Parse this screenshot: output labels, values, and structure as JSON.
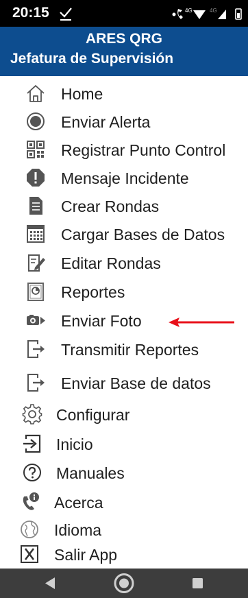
{
  "status": {
    "time": "20:15",
    "net_label": "4G"
  },
  "header": {
    "title": "ARES QRG",
    "subtitle": "Jefatura de Supervisión"
  },
  "menu": [
    {
      "label": "Home",
      "icon": "home-icon"
    },
    {
      "label": "Enviar Alerta",
      "icon": "alert-radio-icon"
    },
    {
      "label": "Registrar Punto Control",
      "icon": "qr-code-icon"
    },
    {
      "label": "Mensaje Incidente",
      "icon": "exclamation-icon"
    },
    {
      "label": "Crear Rondas",
      "icon": "checklist-icon"
    },
    {
      "label": "Cargar Bases de Datos",
      "icon": "spreadsheet-icon"
    },
    {
      "label": "Editar Rondas",
      "icon": "edit-document-icon"
    },
    {
      "label": "Reportes",
      "icon": "report-chart-icon"
    },
    {
      "label": "Enviar Foto",
      "icon": "camera-icon"
    },
    {
      "label": "Transmitir Reportes",
      "icon": "file-export-icon"
    },
    {
      "label": "Enviar Base de datos",
      "icon": "file-export-icon"
    },
    {
      "label": "Configurar",
      "icon": "gear-icon"
    },
    {
      "label": "Inicio",
      "icon": "sign-in-icon"
    },
    {
      "label": "Manuales",
      "icon": "help-circle-icon"
    },
    {
      "label": "Acerca",
      "icon": "phone-info-icon"
    },
    {
      "label": "Idioma",
      "icon": "globe-icon"
    },
    {
      "label": "Salir App",
      "icon": "exit-x-icon"
    }
  ],
  "colors": {
    "header_bg": "#0d4d8f",
    "arrow": "#e8101a",
    "navbar_bg": "#3d3d3d"
  }
}
